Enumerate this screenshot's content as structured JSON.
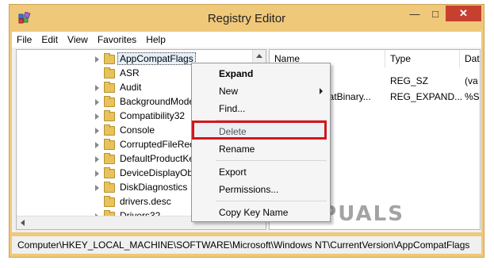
{
  "window": {
    "title": "Registry Editor",
    "controls": {
      "minimize": "—",
      "maximize": "□",
      "close": "✕"
    }
  },
  "menubar": [
    "File",
    "Edit",
    "View",
    "Favorites",
    "Help"
  ],
  "tree": {
    "items": [
      {
        "label": "AppCompatFlags",
        "selected": true
      },
      {
        "label": "ASR"
      },
      {
        "label": "Audit"
      },
      {
        "label": "BackgroundMode"
      },
      {
        "label": "Compatibility32"
      },
      {
        "label": "Console"
      },
      {
        "label": "CorruptedFileRec"
      },
      {
        "label": "DefaultProductKe"
      },
      {
        "label": "DeviceDisplayObj"
      },
      {
        "label": "DiskDiagnostics"
      },
      {
        "label": "drivers.desc"
      },
      {
        "label": "Drivers32"
      }
    ]
  },
  "values_pane": {
    "headers": {
      "name": "Name",
      "type": "Type",
      "data": "Dat"
    },
    "rows": [
      {
        "name": "",
        "type": "REG_SZ",
        "data": "(va"
      },
      {
        "name": "patBinary...",
        "type": "REG_EXPAND...",
        "data": "%S"
      }
    ]
  },
  "context_menu": {
    "expand": "Expand",
    "new": "New",
    "find": "Find...",
    "delete": "Delete",
    "rename": "Rename",
    "export": "Export",
    "permissions": "Permissions...",
    "copy_key_name": "Copy Key Name"
  },
  "status_path": "Computer\\HKEY_LOCAL_MACHINE\\SOFTWARE\\Microsoft\\Windows NT\\CurrentVersion\\AppCompatFlags",
  "watermark": "APPUALS",
  "colors": {
    "frame": "#f0c87a",
    "close": "#c7402f",
    "highlight_box": "#d2161c"
  }
}
